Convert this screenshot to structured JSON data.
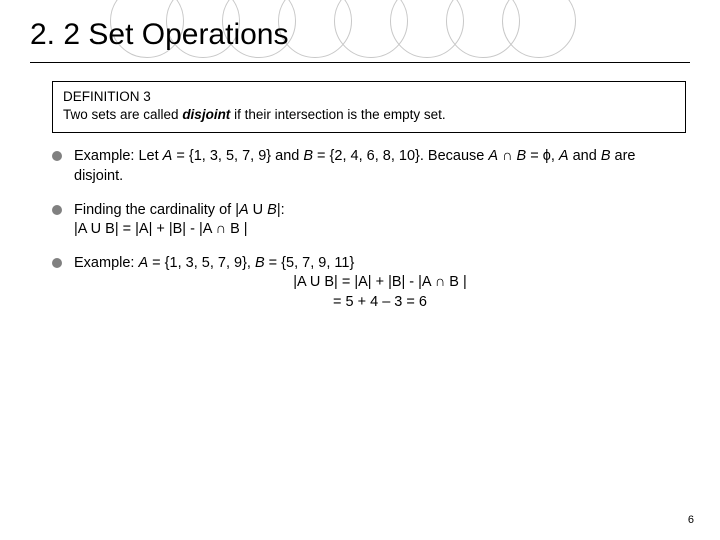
{
  "title": "2. 2 Set Operations",
  "definition": {
    "label": "DEFINITION 3",
    "text_before": "Two sets are called ",
    "term": "disjoint",
    "text_after": " if their intersection is the empty set."
  },
  "bullets": {
    "b1_prefix": "Example: Let ",
    "b1_A": "A",
    "b1_mid1": " = {1, 3, 5, 7, 9} and ",
    "b1_B": "B",
    "b1_mid2": " = {2, 4, 6, 8, 10}. Because ",
    "b1_expr_open": "A",
    "b1_inter": " ∩ ",
    "b1_expr_close": "B",
    "b1_end": " = ϕ, ",
    "b1_A2": "A",
    "b1_and": " and ",
    "b1_B2": "B",
    "b1_tail": " are disjoint.",
    "b2_line1_pre": "Finding the cardinality of |",
    "b2_line1_A": "A",
    "b2_line1_u": " U ",
    "b2_line1_B": "B",
    "b2_line1_post": "|:",
    "b2_line2": "|A U B| = |A| + |B| - |A ∩ B |",
    "b3_pre": "Example: ",
    "b3_A": "A",
    "b3_mid1": " = {1, 3, 5, 7, 9}, ",
    "b3_B": "B",
    "b3_mid2": " = {5, 7, 9, 11}",
    "b3_centered_l1": "|A U B| = |A| + |B| - |A ∩ B |",
    "b3_centered_l2": "= 5 + 4 – 3 = 6"
  },
  "page_number": "6"
}
